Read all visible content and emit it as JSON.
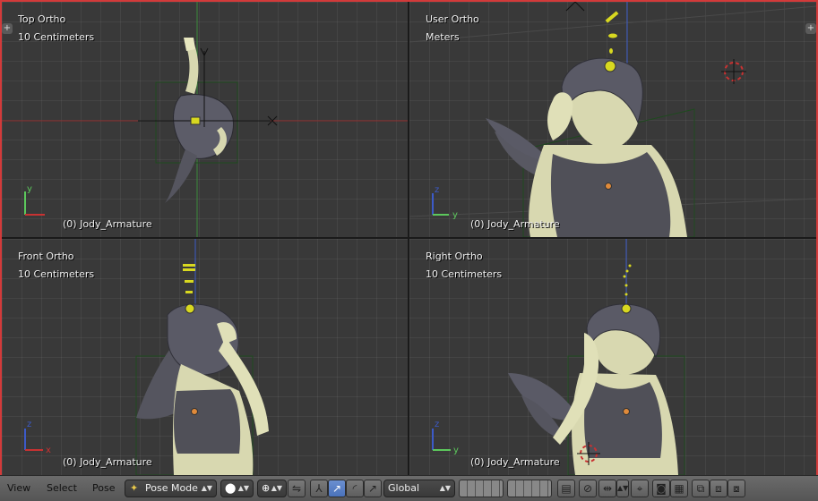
{
  "viewports": {
    "top": {
      "view_name": "Top Ortho",
      "scale": "10 Centimeters",
      "object": "(0) Jody_Armature"
    },
    "user": {
      "view_name": "User Ortho",
      "scale": "Meters",
      "object": "(0) Jody_Armature"
    },
    "front": {
      "view_name": "Front Ortho",
      "scale": "10 Centimeters",
      "object": "(0) Jody_Armature"
    },
    "right": {
      "view_name": "Right Ortho",
      "scale": "10 Centimeters",
      "object": "(0) Jody_Armature"
    }
  },
  "axis_labels": {
    "x": "x",
    "y": "y",
    "z": "z"
  },
  "header": {
    "menus": {
      "view": "View",
      "select": "Select",
      "pose": "Pose"
    },
    "mode": "Pose Mode",
    "orientation": "Global",
    "plus": "+"
  },
  "colors": {
    "viewport_bg": "#393939",
    "x_axis": "#c83232",
    "y_axis": "#5cc85c",
    "z_axis": "#3c5ac8",
    "bone": "#d8d820",
    "bounding_box": "#1e4a1e",
    "hair": "#5a5a66",
    "skin": "#d8d8b0",
    "top": "#505058",
    "active_button": "#5a7ec6"
  }
}
